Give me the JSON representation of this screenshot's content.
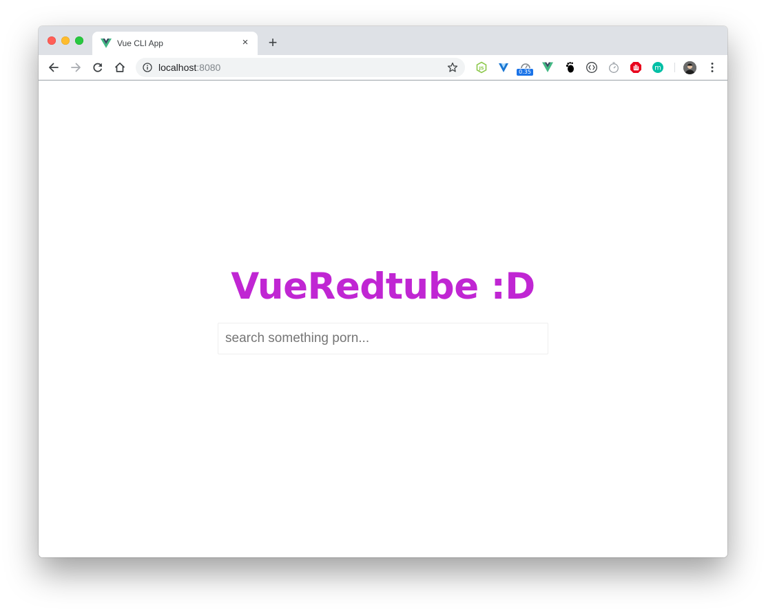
{
  "browser": {
    "tab": {
      "title": "Vue CLI App",
      "favicon": "vue-logo-icon",
      "close_symbol": "×"
    },
    "new_tab_symbol": "+",
    "address": {
      "host": "localhost",
      "port": ":8080"
    },
    "extensions": [
      {
        "name": "nodejs-icon",
        "color": "#8cc84b"
      },
      {
        "name": "vuetify-icon",
        "color": "#1976d2"
      },
      {
        "name": "speed-gauge-icon",
        "badge": "0.35",
        "badge_color": "#1a73e8"
      },
      {
        "name": "vue-devtools-icon",
        "color": "#41b883"
      },
      {
        "name": "gnome-foot-icon",
        "color": "#000000"
      },
      {
        "name": "code-brackets-icon",
        "color": "#3c4043"
      },
      {
        "name": "timer-icon",
        "color": "#9aa0a6"
      },
      {
        "name": "hand-stop-icon",
        "color": "#e8001c"
      },
      {
        "name": "m-circle-icon",
        "color": "#00bfa5",
        "letter": "m"
      }
    ]
  },
  "page": {
    "heading": "VueRedtube :D",
    "heading_color": "#c026d3",
    "search": {
      "value": "",
      "placeholder": "search something porn..."
    }
  }
}
